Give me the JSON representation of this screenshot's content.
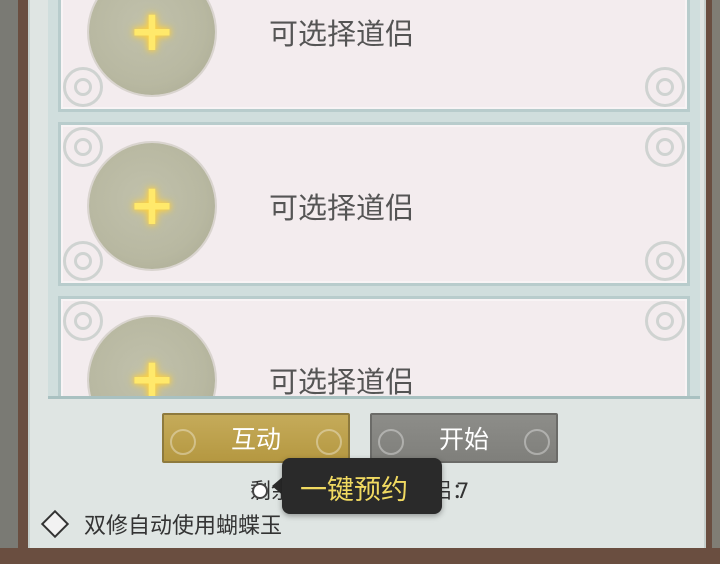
{
  "slots": [
    {
      "label": "可选择道侣"
    },
    {
      "label": "可选择道侣"
    },
    {
      "label": "可选择道侣"
    }
  ],
  "buttons": {
    "interact": "互动",
    "start": "开始"
  },
  "remaining": {
    "label": "剩余可",
    "label_suffix": "侣：",
    "count": "7"
  },
  "tooltip": {
    "text": "一键预约"
  },
  "auto_option": {
    "label": "双修自动使用蝴蝶玉",
    "checked": false
  },
  "colors": {
    "button_gold": "#b59841",
    "button_gray": "#7f7f7b",
    "tooltip_text": "#f1da61",
    "plus_glow": "#ffe96b"
  },
  "icons": {
    "slot_add": "plus-icon",
    "checkbox": "diamond-checkbox-icon"
  }
}
